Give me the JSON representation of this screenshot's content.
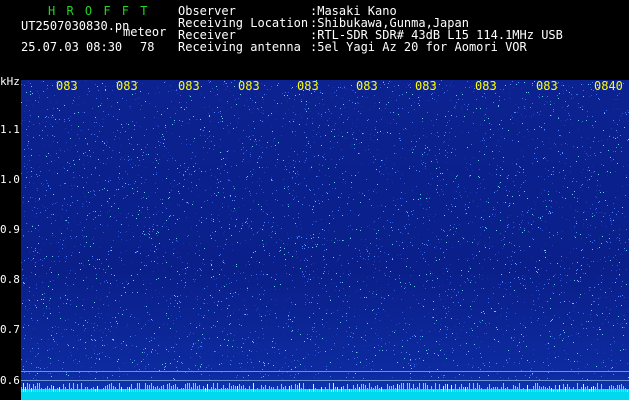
{
  "header": {
    "logo": "H R O F F T",
    "filename": "UT2507030830.pn",
    "meteor_label": "meteor",
    "datetime": "25.07.03 08:30",
    "count": "78",
    "fields": [
      {
        "label": "Observer",
        "value": ":Masaki Kano"
      },
      {
        "label": "Receiving Location",
        "value": ":Shibukawa,Gunma,Japan"
      },
      {
        "label": "Receiver",
        "value": ":RTL-SDR SDR# 43dB L15 114.1MHz USB"
      },
      {
        "label": "Receiving antenna",
        "value": ":5el Yagi Az 20 for Aomori VOR"
      }
    ]
  },
  "axis": {
    "unit": "kHz",
    "y_ticks": [
      "1.1",
      "1.0",
      "0.9",
      "0.8",
      "0.7",
      "0.6"
    ],
    "x_ticks": [
      "083",
      "083",
      "083",
      "083",
      "083",
      "083",
      "083",
      "083",
      "083",
      "0840"
    ]
  },
  "colors": {
    "background": "#0a1f8a",
    "header_text": "#ffffff",
    "logo": "#22d522",
    "x_tick": "#ffff00",
    "baseline": "#00d8f0"
  }
}
